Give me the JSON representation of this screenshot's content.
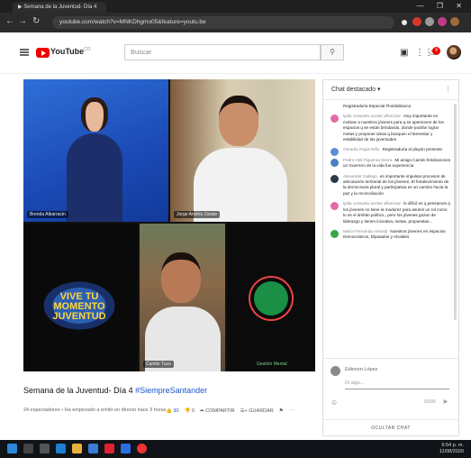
{
  "browser": {
    "tab_title": "▶ Semana de la Juventud- Día 4",
    "url": "youtube.com/watch?v=MNKDhgmo05&feature=youtu.be",
    "window_controls": "— ❐ ✕"
  },
  "header": {
    "logo_text": "YouTube",
    "logo_region": "CO",
    "search_placeholder": "Buscar",
    "notification_count": "9"
  },
  "video": {
    "panes": [
      {
        "label": "Brenda Albarracin"
      },
      {
        "label": "Jorge Andrés Zarate"
      },
      {
        "label": ""
      },
      {
        "label": "Camilo Tuza"
      },
      {
        "label": "Gestión Mental"
      }
    ],
    "logo_text": "VIVE TU MOMENTO JUVENTUD"
  },
  "info": {
    "title_main": "Semana de la Juventud- Día 4",
    "title_tag": "#SiempreSantander",
    "meta": "24 espectadores • Ha empezado a emitir en directo hace 3 horas",
    "likes": "30",
    "dislikes": "0",
    "share_label": "COMPARTIR",
    "save_label": "GUARDAR"
  },
  "chat": {
    "header": "Chat destacado",
    "messages": [
      {
        "author": "",
        "text": "Registraduría Especial Floridablanca",
        "color": "#ffffff"
      },
      {
        "author": "lydia consuelo acelas villamizar",
        "text": "muy importante es motivar a nuestros jóvenes para q se apersonen de los espacios q se están brindando, donde podrán lograr metas y proponer ideas q busquen el bienestar y estabilidad de las juventudes",
        "color": "#e66aa8"
      },
      {
        "author": "Gerardo Rojas Niño",
        "text": "Registraduría el playón presente",
        "color": "#5a8fd8"
      },
      {
        "author": "Pedro Heli Figueroa Sierra",
        "text": "Mi amigo Camilo felicitaciones un Guerrero de la vida fue experiencia",
        "color": "#4a7fc0"
      },
      {
        "author": "Alexander Gallego",
        "text": "es importante impulsar procesos de articulación territorial de los jóvenes. El fortalecimiento de la democracia plural y participativa es un camino hacia la paz y la reconciliación",
        "color": "#2c3a4a"
      },
      {
        "author": "lydia consuelo acelas villamizar",
        "text": "lo difícil es q pensamos q los jóvenes no tiene la madurez para asumir un rol como lo es el ámbito político,, pero los jóvenes gozan de liderazgo y tienen iniciativa, metas, propuestas...",
        "color": "#e66aa8"
      },
      {
        "author": "María Fernanda Arévalo",
        "text": "Nuestros jóvenes en espacios Democráticos, Diputados y Alcaldes",
        "color": "#3aa64a"
      }
    ],
    "user_name": "Edinson López",
    "say_placeholder": "Di algo...",
    "char_count": "0/200",
    "hide_label": "OCULTAR CHAT"
  },
  "taskbar": {
    "time": "6:54 p. m.",
    "date": "11/08/2020"
  }
}
